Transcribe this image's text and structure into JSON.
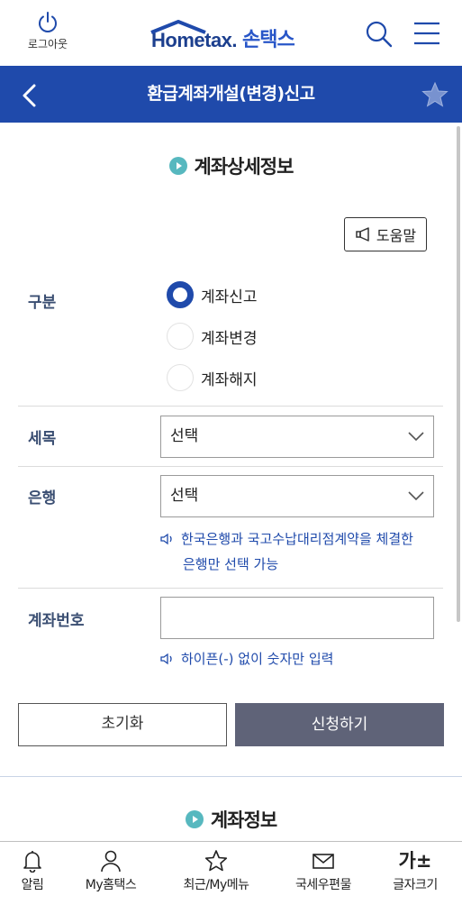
{
  "header": {
    "logout_label": "로그아웃",
    "logo_text": "Hometax.",
    "logo_sub": "손택스"
  },
  "titlebar": {
    "title": "환급계좌개설(변경)신고"
  },
  "detail_section": {
    "heading": "계좌상세정보",
    "help_label": "도움말",
    "category_label": "구분",
    "radio_options": [
      {
        "label": "계좌신고",
        "checked": true
      },
      {
        "label": "계좌변경",
        "checked": false
      },
      {
        "label": "계좌해지",
        "checked": false
      }
    ],
    "tax_item_label": "세목",
    "tax_item_value": "선택",
    "bank_label": "은행",
    "bank_value": "선택",
    "bank_hint_line1": "한국은행과 국고수납대리점계약을 체결한",
    "bank_hint_line2": "은행만 선택 가능",
    "account_label": "계좌번호",
    "account_value": "",
    "account_hint": "하이픈(-) 없이 숫자만 입력"
  },
  "actions": {
    "reset_label": "초기화",
    "apply_label": "신청하기"
  },
  "account_section": {
    "heading": "계좌정보"
  },
  "bottom_nav": [
    {
      "label": "알림",
      "icon": "bell-icon"
    },
    {
      "label": "My홈택스",
      "icon": "person-icon"
    },
    {
      "label": "최근/My메뉴",
      "icon": "star-outline-icon"
    },
    {
      "label": "국세우편물",
      "icon": "envelope-icon"
    },
    {
      "label": "글자크기",
      "icon": "font-size-icon",
      "icon_text": "가±"
    }
  ],
  "colors": {
    "primary": "#1f4aab",
    "label": "#3a4e72",
    "apply_button": "#5f6378",
    "accent_dot": "#57b8bf"
  }
}
